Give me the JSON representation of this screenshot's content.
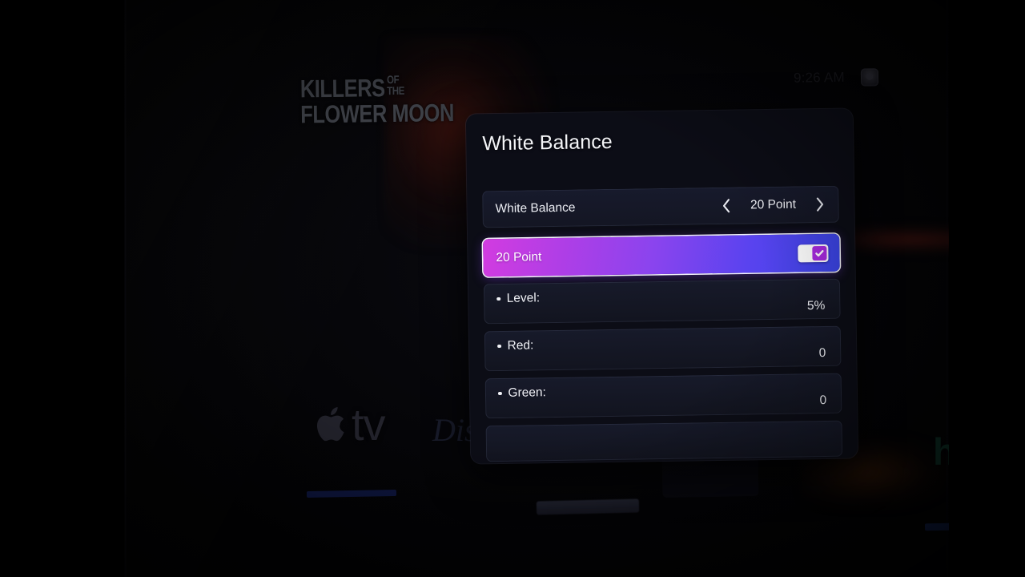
{
  "screen": {
    "status_bar": {
      "time": "9:26 AM",
      "avatar_name": "profile-avatar"
    },
    "background": {
      "movie_title_line1_main": "KILLERS",
      "movie_title_line1_of": "OF",
      "movie_title_line1_the": "THE",
      "movie_title_line2": "FLOWER MOON",
      "apps": [
        {
          "name": "apple-tv",
          "label": "tv"
        },
        {
          "name": "disney-plus",
          "label": "Dis"
        },
        {
          "name": "hulu",
          "label": "hulu"
        }
      ]
    }
  },
  "dialog": {
    "title": "White Balance",
    "selector": {
      "label": "White Balance",
      "value": "20 Point",
      "prev_icon": "chevron-left-icon",
      "next_icon": "chevron-right-icon"
    },
    "focused_row": {
      "label": "20 Point",
      "toggle_state": "checked",
      "check_icon": "checkmark-icon"
    },
    "rows": [
      {
        "label": "Level:",
        "value": "5%"
      },
      {
        "label": "Red:",
        "value": "0"
      },
      {
        "label": "Green:",
        "value": "0"
      }
    ],
    "colors": {
      "highlight_start": "#d23ce0",
      "highlight_end": "#3a45e8",
      "checkbox": "#a82ae0",
      "panel_bg": "#0c0d16",
      "row_bg": "#171a2a"
    }
  }
}
